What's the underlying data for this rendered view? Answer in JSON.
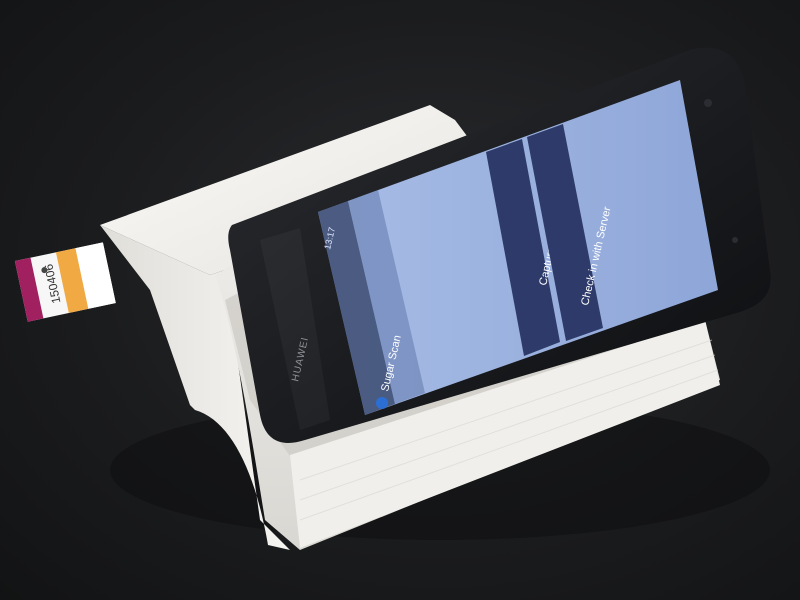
{
  "scene": {
    "test_strip_code": "150406",
    "phone_brand": "HUAWEI",
    "phone_app": {
      "app_title": "Sugar Scan",
      "capture_label": "Capture",
      "check_in_label": "Check in with Server",
      "status_time": "13:17"
    }
  },
  "colors": {
    "background": "#1c1d1f",
    "stand": "#f2f1ee",
    "phone_body": "#111214",
    "screen": "#9fb6e2",
    "button": "#2e3b6a",
    "strip_magenta": "#a12060",
    "strip_orange": "#f0a030"
  }
}
